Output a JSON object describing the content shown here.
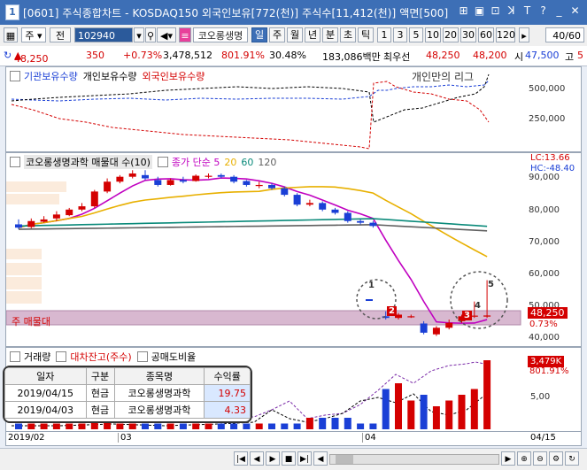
{
  "window": {
    "title": "[0601] 주식종합차트 - KOSDAQ150 외국인보유[772(천)] 주식수[11,412(천)] 액면[500]",
    "icon_text": "1",
    "buttons": [
      {
        "name": "link-icon",
        "glyph": "⊞"
      },
      {
        "name": "save-icon",
        "glyph": "▣"
      },
      {
        "name": "print-icon",
        "glyph": "⊡"
      },
      {
        "name": "font-icon",
        "glyph": "ꓘ"
      },
      {
        "name": "text-icon",
        "glyph": "T"
      },
      {
        "name": "help-icon",
        "glyph": "?"
      },
      {
        "name": "minimize-icon",
        "glyph": "_"
      },
      {
        "name": "close-icon",
        "glyph": "✕"
      }
    ]
  },
  "toolbar": {
    "market": "주",
    "type": "전",
    "code": "102940",
    "stock_name": "코오롱생명",
    "periods": [
      "일",
      "주",
      "월",
      "년",
      "분",
      "초",
      "틱"
    ],
    "active_period": "일",
    "intervals": [
      "1",
      "3",
      "5",
      "10",
      "20",
      "30",
      "60",
      "120"
    ],
    "count": "40/60"
  },
  "info": {
    "price": "48,250",
    "change": "350",
    "change_pct": "+0.73%",
    "volume": "3,478,512",
    "volume_ratio": "801.91%",
    "turnover_rate": "30.48%",
    "amount": "183,086백만",
    "best_ask_label": "최우선",
    "best_ask": "48,250",
    "best_bid": "48,200",
    "low_label": "시",
    "low_value": "47,500",
    "high_label": "고",
    "high_value": "5"
  },
  "panel1": {
    "legend": [
      {
        "label": "기관보유수량",
        "color": "#1a3fd6"
      },
      {
        "label": "개인보유수량",
        "color": "#000000"
      },
      {
        "label": "외국인보유수량",
        "color": "#d40000"
      }
    ],
    "note": "개인만의 리그",
    "y_ticks": [
      "500,000",
      "250,000"
    ]
  },
  "panel2": {
    "legend_label": "코오롱생명과학 매물대 수(10)",
    "ma_label": "종가 단순",
    "ma_periods": [
      "5",
      "20",
      "60",
      "120"
    ],
    "ma_colors": [
      "#c000c0",
      "#e8b000",
      "#0a8a7a",
      "#606060"
    ],
    "lc": "LC:13.66",
    "hc": "HC:-48.40",
    "y_ticks": [
      "90,000",
      "80,000",
      "70,000",
      "60,000",
      "50,000",
      "40,000"
    ],
    "price_badge": "48,250",
    "pct_label": "0.73%",
    "band_label": "주 매물대",
    "annotations": [
      "1",
      "2",
      "3",
      "4",
      "5"
    ]
  },
  "panel3": {
    "legend": [
      {
        "label": "거래량",
        "color": "#000000"
      },
      {
        "label": "대차잔고(주수)",
        "color": "#d40000"
      },
      {
        "label": "공매도비율",
        "color": "#000000"
      }
    ],
    "vol_badge": "3,479K",
    "vol_pct": "801.91%",
    "y_ticks": [
      "5,00"
    ]
  },
  "xaxis": {
    "labels": [
      "2019/02",
      "03",
      "04",
      "04/15"
    ]
  },
  "trades_table": {
    "headers": [
      "일자",
      "구분",
      "종목명",
      "수익률"
    ],
    "rows": [
      [
        "2019/04/15",
        "현금",
        "코오롱생명과학",
        "19.75"
      ],
      [
        "2019/04/03",
        "현금",
        "코오롱생명과학",
        "4.33"
      ]
    ]
  },
  "chart_data": {
    "type": "candlestick",
    "dates_from": "2019/02",
    "dates_to": "2019/04/15",
    "candles": [
      {
        "o": 76000,
        "c": 75000,
        "h": 77500,
        "l": 74500
      },
      {
        "o": 75200,
        "c": 77000,
        "h": 77800,
        "l": 74800
      },
      {
        "o": 76800,
        "c": 77500,
        "h": 78500,
        "l": 76500
      },
      {
        "o": 77800,
        "c": 79000,
        "h": 80000,
        "l": 77000
      },
      {
        "o": 78800,
        "c": 80500,
        "h": 81000,
        "l": 78500
      },
      {
        "o": 80500,
        "c": 81500,
        "h": 82500,
        "l": 80000
      },
      {
        "o": 81500,
        "c": 86000,
        "h": 86500,
        "l": 81000
      },
      {
        "o": 86000,
        "c": 89000,
        "h": 90000,
        "l": 85500
      },
      {
        "o": 89000,
        "c": 90500,
        "h": 91000,
        "l": 88500
      },
      {
        "o": 90500,
        "c": 91500,
        "h": 92500,
        "l": 90000
      },
      {
        "o": 91000,
        "c": 90000,
        "h": 92500,
        "l": 89500
      },
      {
        "o": 89500,
        "c": 88000,
        "h": 90500,
        "l": 87500
      },
      {
        "o": 88000,
        "c": 89500,
        "h": 90000,
        "l": 87800
      },
      {
        "o": 89500,
        "c": 89000,
        "h": 90500,
        "l": 88500
      },
      {
        "o": 89200,
        "c": 90800,
        "h": 91200,
        "l": 89000
      },
      {
        "o": 90800,
        "c": 90800,
        "h": 91500,
        "l": 90000
      },
      {
        "o": 91000,
        "c": 90500,
        "h": 91500,
        "l": 90000
      },
      {
        "o": 90500,
        "c": 89000,
        "h": 91000,
        "l": 88500
      },
      {
        "o": 89200,
        "c": 88000,
        "h": 89500,
        "l": 87500
      },
      {
        "o": 88000,
        "c": 88000,
        "h": 89000,
        "l": 87000
      },
      {
        "o": 88000,
        "c": 87000,
        "h": 88500,
        "l": 86500
      },
      {
        "o": 87000,
        "c": 85000,
        "h": 87500,
        "l": 84500
      },
      {
        "o": 85000,
        "c": 82000,
        "h": 85500,
        "l": 81500
      },
      {
        "o": 82000,
        "c": 82500,
        "h": 83500,
        "l": 81500
      },
      {
        "o": 82500,
        "c": 80500,
        "h": 83000,
        "l": 80000
      },
      {
        "o": 80500,
        "c": 79500,
        "h": 81000,
        "l": 79000
      },
      {
        "o": 79500,
        "c": 77000,
        "h": 80000,
        "l": 76500
      },
      {
        "o": 77000,
        "c": 76500,
        "h": 77500,
        "l": 76000
      },
      {
        "o": 76500,
        "c": 75500,
        "h": 77000,
        "l": 75000
      },
      {
        "o": 48000,
        "c": 47500,
        "h": 49500,
        "l": 47000
      },
      {
        "o": 47500,
        "c": 48500,
        "h": 49000,
        "l": 47000
      },
      {
        "o": 48000,
        "c": 48000,
        "h": 48500,
        "l": 47500
      },
      {
        "o": 45800,
        "c": 43000,
        "h": 46500,
        "l": 42500
      },
      {
        "o": 42500,
        "c": 44500,
        "h": 45000,
        "l": 42000
      },
      {
        "o": 44500,
        "c": 46000,
        "h": 47000,
        "l": 44000
      },
      {
        "o": 46500,
        "c": 48000,
        "h": 48500,
        "l": 46000
      },
      {
        "o": 48000,
        "c": 48200,
        "h": 52500,
        "l": 47500
      },
      {
        "o": 47900,
        "c": 48250,
        "h": 59000,
        "l": 47500
      }
    ],
    "volume": [
      1,
      1,
      1,
      1,
      1,
      1,
      2,
      2,
      1,
      1,
      1,
      1,
      1,
      1,
      1,
      1,
      1,
      1,
      1,
      1,
      1,
      1,
      1,
      2,
      2,
      2,
      2,
      1,
      1,
      7,
      8,
      5,
      6,
      4,
      5,
      6,
      7,
      12
    ],
    "ylim": [
      40000,
      95000
    ]
  }
}
